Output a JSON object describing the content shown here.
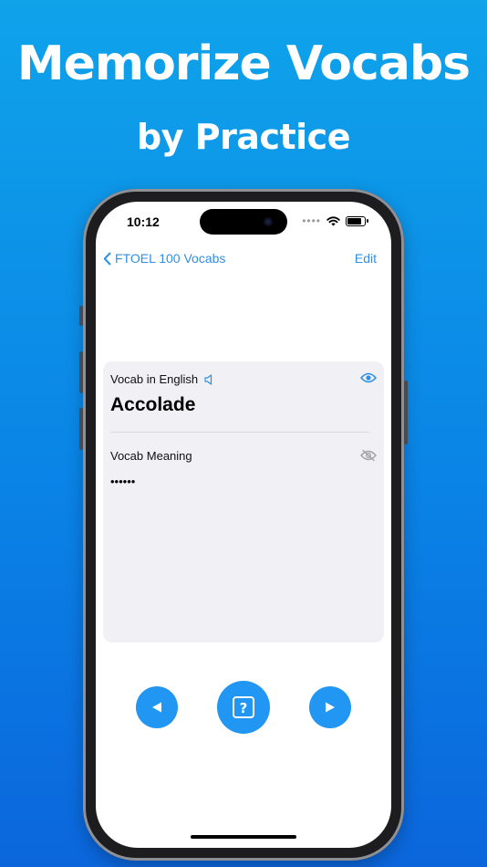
{
  "promo": {
    "headline": "Memorize Vocabs",
    "subheadline": "by Practice"
  },
  "status_bar": {
    "time": "10:12",
    "dots": "••••",
    "battery_level": 0.85
  },
  "nav": {
    "back_label": "FTOEL 100 Vocabs",
    "edit_label": "Edit"
  },
  "card": {
    "english_label": "Vocab in English",
    "word": "Accolade",
    "meaning_label": "Vocab Meaning",
    "meaning_masked": "••••••"
  },
  "controls": {
    "prev_icon": "previous-icon",
    "quiz_icon": "question-icon",
    "next_icon": "next-icon"
  },
  "colors": {
    "accent": "#2f8fe6",
    "button_fill": "#2196f3",
    "card_bg": "#f0f0f5",
    "eye_hidden": "#a0a0a6"
  }
}
